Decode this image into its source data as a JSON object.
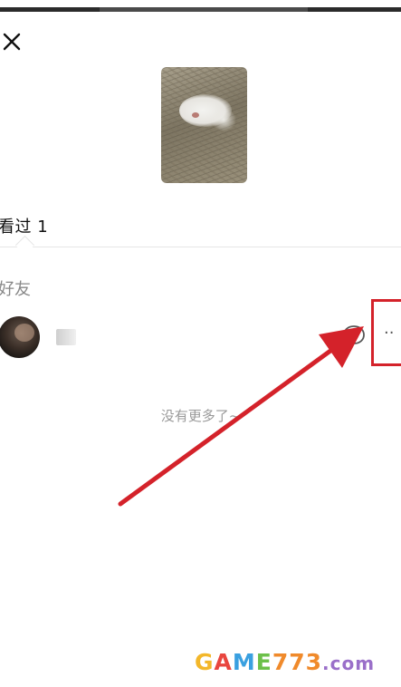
{
  "header": {
    "close_icon": "close-icon",
    "thumbnail": "moment-image-white-dog-in-grass"
  },
  "tabs": {
    "viewed_label": "看过 1"
  },
  "friends": {
    "section_title": "好友",
    "items": [
      {
        "avatar": "avatar-dark",
        "name": "■",
        "comment_icon": "comment-bubble-icon",
        "more_icon": "more-dots-icon",
        "more_label": "··"
      }
    ]
  },
  "footer": {
    "no_more_text": "没有更多了~"
  },
  "annotations": {
    "arrow_color": "#d4222a",
    "highlight_color": "#d4222a"
  },
  "watermark": {
    "g": "G",
    "a": "A",
    "m": "M",
    "e": "E",
    "num": "773",
    "dot": ".com"
  }
}
